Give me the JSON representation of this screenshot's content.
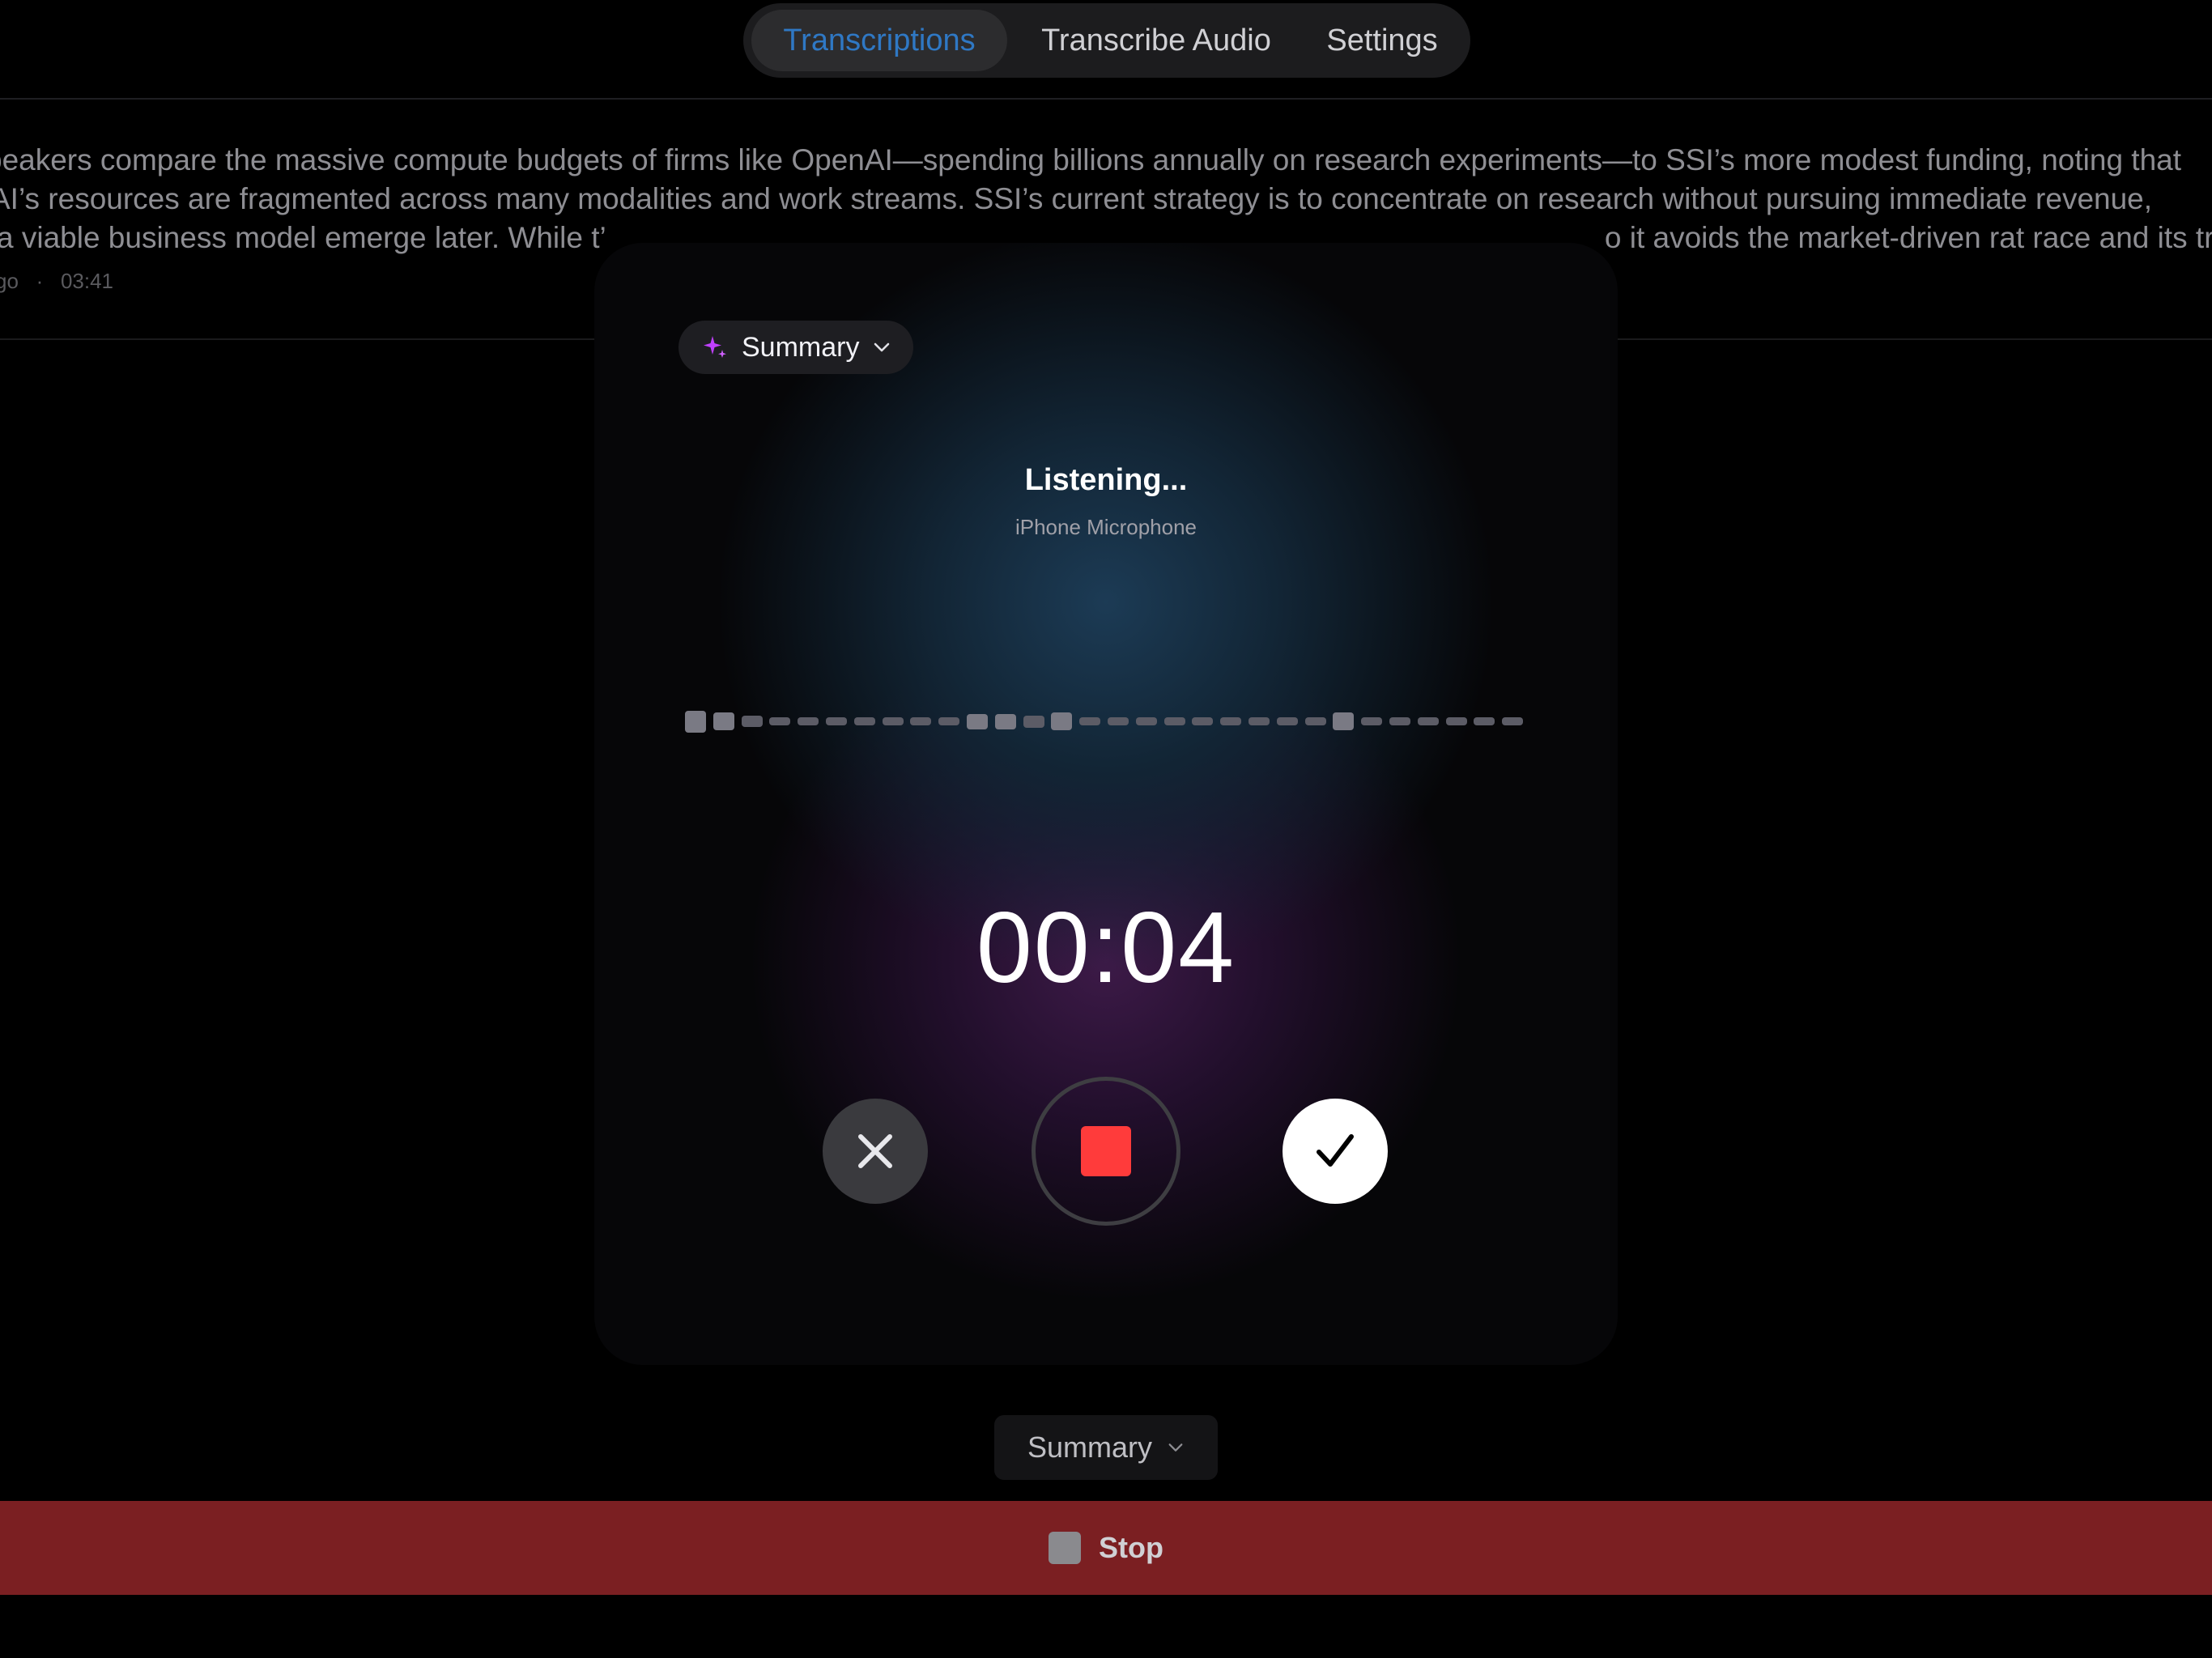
{
  "nav": {
    "tabs": [
      {
        "label": "Transcriptions",
        "active": true
      },
      {
        "label": "Transcribe Audio",
        "active": false
      },
      {
        "label": "Settings",
        "active": false
      }
    ]
  },
  "transcript": {
    "line1": "peakers compare the massive compute budgets of firms like OpenAI—spending billions annually on research experiments—to SSI’s more modest funding, noting that",
    "line2": "AI’s resources are fragmented across many modalities and work streams. SSI’s current strategy is to concentrate on research without pursuing immediate revenue,",
    "line3a": "a viable business model emerge later. While t’",
    "line3b": "o it avoids the market-driven rat race and its tr",
    "meta_prefix": "go",
    "meta_sep": "·",
    "meta_duration": "03:41"
  },
  "recorder": {
    "mode_label": "Summary",
    "status_title": "Listening...",
    "status_source": "iPhone Microphone",
    "timer": "00:04",
    "waveform_levels": [
      0.8,
      0.65,
      0.4,
      0.15,
      0.15,
      0.15,
      0.15,
      0.15,
      0.15,
      0.3,
      0.55,
      0.55,
      0.45,
      0.65,
      0.15,
      0.15,
      0.15,
      0.15,
      0.15,
      0.15,
      0.15,
      0.15,
      0.15,
      0.65,
      0.15,
      0.15,
      0.15,
      0.15,
      0.15,
      0.15
    ]
  },
  "bottom": {
    "summary_label": "Summary",
    "stop_label": "Stop"
  },
  "colors": {
    "accent_blue": "#2f78c4",
    "stop_red": "#ff3b3b",
    "stopbar_bg": "#7b1f22",
    "sparkle": "#c040ff"
  }
}
